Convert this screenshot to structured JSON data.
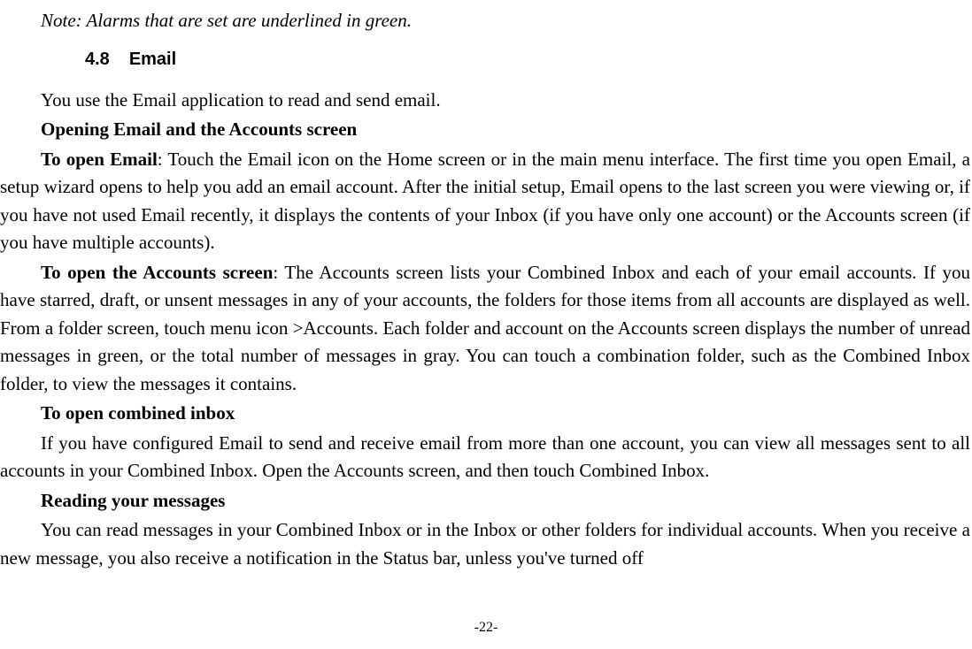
{
  "note": "Note: Alarms that are set are underlined in green.",
  "section": {
    "number": "4.8",
    "title": "Email"
  },
  "intro": "You use the Email application to read and send email.",
  "heading1": "Opening Email and the Accounts screen",
  "p1_bold": "To open Email",
  "p1_rest": ": Touch the Email icon on the Home screen or in the main menu interface. The first time you open Email, a setup wizard opens to help you you add an email account. After the initial setup, Email opens to the last screen you were viewing or, if you have not used Email recently, it displays the contents of your Inbox (if you have only one account) or the Accounts screen (if you have multiple accounts).",
  "p2_bold": "To open the Accounts screen",
  "p2_rest": ": The Accounts screen lists your Combined Inbox and each of your email accounts. If you have starred, draft, or unsent messages in any of your accounts, the folders for those items from all accounts are displayed as well. From a folder screen, touch menu icon >Accounts. Each folder and account on the Accounts screen displays the number of unread messages in green, or the total number of messages in gray. You can touch a combination folder, such as the Combined Inbox folder, to view the messages it contains.",
  "heading2": "To open combined inbox",
  "p3": "If you have configured Email to send and receive email from more than one account, you can view all messages sent to all accounts in your Combined Inbox. Open the Accounts screen, and then touch Combined Inbox.",
  "heading3": "Reading your messages",
  "p4": "You can read messages in your Combined Inbox or in the Inbox or other folders for individual accounts. When you receive a new message, you also receive a notification in the Status bar, unless you've turned off",
  "page_number": "-22-"
}
